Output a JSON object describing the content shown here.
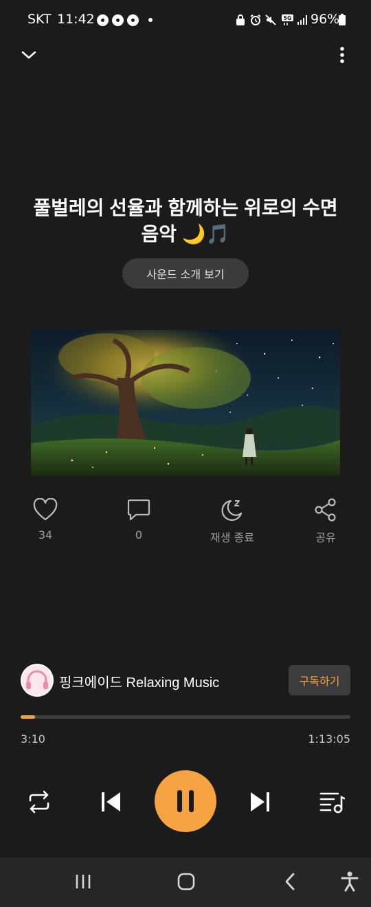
{
  "status_bar": {
    "carrier": "SKT",
    "time": "11:42",
    "battery": "96%",
    "network": "5G"
  },
  "top_bar": {
    "collapse_icon": "chevron-down-icon",
    "more_icon": "more-vert-icon"
  },
  "sound": {
    "title": "풀벌레의 선율과 함께하는 위로의 수면음악 🌙🎵",
    "intro_button": "사운드 소개 보기"
  },
  "actions": [
    {
      "icon": "heart-icon",
      "label": "34"
    },
    {
      "icon": "comment-icon",
      "label": "0"
    },
    {
      "icon": "sleep-timer-icon",
      "label": "재생 종료"
    },
    {
      "icon": "share-icon",
      "label": "공유"
    }
  ],
  "channel": {
    "name": "핑크에이드 Relaxing Music",
    "subscribe_label": "구독하기"
  },
  "player": {
    "current_time": "3:10",
    "total_time": "1:13:05",
    "progress_fraction": 0.0434,
    "accent_color": "#f6a443",
    "state": "playing"
  },
  "controls": {
    "repeat_icon": "repeat-icon",
    "previous_icon": "skip-previous-icon",
    "pause_icon": "pause-icon",
    "next_icon": "skip-next-icon",
    "playlist_icon": "playlist-music-icon"
  },
  "nav_bar": {
    "recents_icon": "recents-icon",
    "home_icon": "home-icon",
    "back_icon": "back-icon",
    "accessibility_icon": "accessibility-icon"
  }
}
